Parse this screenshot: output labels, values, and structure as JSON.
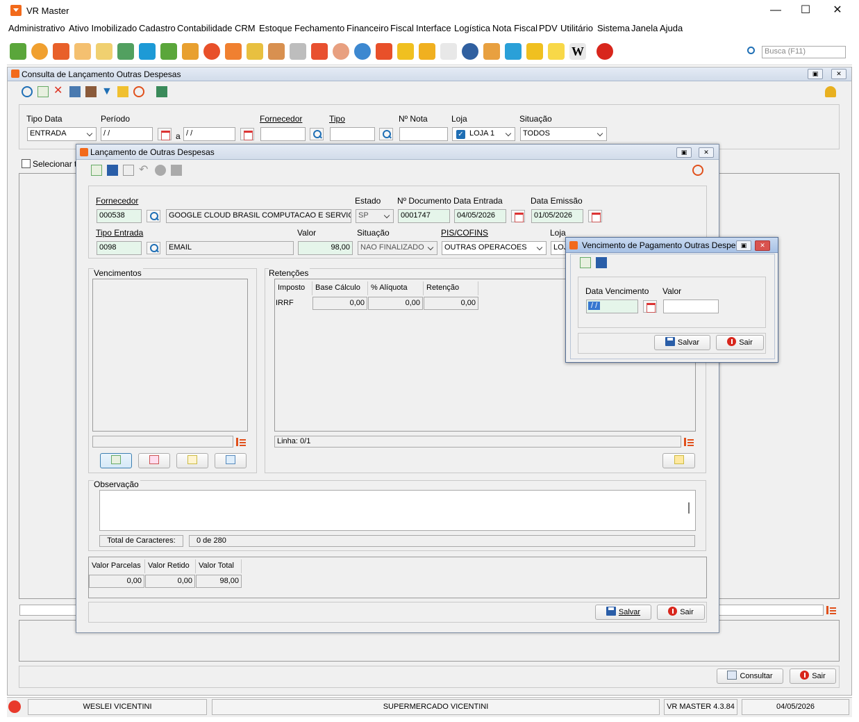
{
  "app": {
    "title": "VR Master"
  },
  "menu": [
    "Administrativo",
    "Ativo Imobilizado",
    "Cadastro",
    "Contabilidade",
    "CRM",
    "Estoque",
    "Fechamento",
    "Financeiro",
    "Fiscal",
    "Interface",
    "Logística",
    "Nota Fiscal",
    "PDV",
    "Utilitário",
    "Sistema",
    "Janela",
    "Ajuda"
  ],
  "search": {
    "placeholder": "Busca (F11)"
  },
  "consulta": {
    "title": "Consulta de Lançamento Outras Despesas",
    "labels": {
      "tipo_data": "Tipo Data",
      "periodo": "Período",
      "fornecedor": "Fornecedor",
      "tipo": "Tipo",
      "nota": "Nº Nota",
      "loja": "Loja",
      "situacao": "Situação",
      "a": "a"
    },
    "values": {
      "tipo_data": "ENTRADA",
      "periodo_ini": " / /",
      "periodo_fim": " / /",
      "fornecedor": "",
      "tipo": "",
      "nota": "",
      "loja": "LOJA 1",
      "situacao": "TODOS"
    },
    "selecionar": "Selecionar to",
    "consultar_label": "Consultar",
    "sair_label": "Sair"
  },
  "lancamento": {
    "title": "Lançamento de Outras Despesas",
    "labels": {
      "fornecedor": "Fornecedor",
      "estado": "Estado",
      "documento": "Nº Documento",
      "data_entrada": "Data Entrada",
      "data_emissao": "Data Emissão",
      "tipo_entrada": "Tipo Entrada",
      "valor": "Valor",
      "situacao": "Situação",
      "pis_cofins": "PIS/COFINS",
      "loja": "Loja"
    },
    "values": {
      "fornecedor_cod": "000538",
      "fornecedor_nome": "GOOGLE CLOUD BRASIL COMPUTACAO E SERVICO",
      "estado": "SP",
      "documento": "0001747",
      "data_entrada": "04/05/2026",
      "data_emissao": "01/05/2026",
      "tipo_entrada_cod": "0098",
      "tipo_entrada_nome": "EMAIL",
      "valor": "98,00",
      "situacao": "NAO FINALIZADO",
      "pis_cofins": "OUTRAS OPERACOES",
      "loja": "LOJ"
    },
    "vencimentos_title": "Vencimentos",
    "retencoes_title": "Retenções",
    "retencoes_headers": [
      "Imposto",
      "Base Cálculo",
      "% Alíquota",
      "Retenção"
    ],
    "retencoes_rows": [
      {
        "imposto": "IRRF",
        "base": "0,00",
        "aliquota": "0,00",
        "retencao": "0,00"
      }
    ],
    "linha_status": "Linha: 0/1",
    "observacao_title": "Observação",
    "total_caracteres_label": "Total de Caracteres:",
    "total_caracteres_value": "0 de 280",
    "totais_headers": [
      "Valor Parcelas",
      "Valor Retido",
      "Valor Total"
    ],
    "totais_values": [
      "0,00",
      "0,00",
      "98,00"
    ],
    "salvar_label": "Salvar",
    "sair_label": "Sair"
  },
  "vencimento": {
    "title": "Vencimento de Pagamento Outras Despesas",
    "labels": {
      "data": "Data Vencimento",
      "valor": "Valor"
    },
    "values": {
      "data": " / /",
      "valor": ""
    },
    "salvar_label": "Salvar",
    "sair_label": "Sair"
  },
  "status": {
    "user": "WESLEI VICENTINI",
    "empresa": "SUPERMERCADO VICENTINI",
    "versao": "VR MASTER 4.3.84",
    "data": "04/05/2026"
  },
  "colors": {
    "accent": "#f26a1b",
    "save": "#2a5ea8",
    "exit": "#d8261c",
    "field_green": "#e5f5ea"
  }
}
